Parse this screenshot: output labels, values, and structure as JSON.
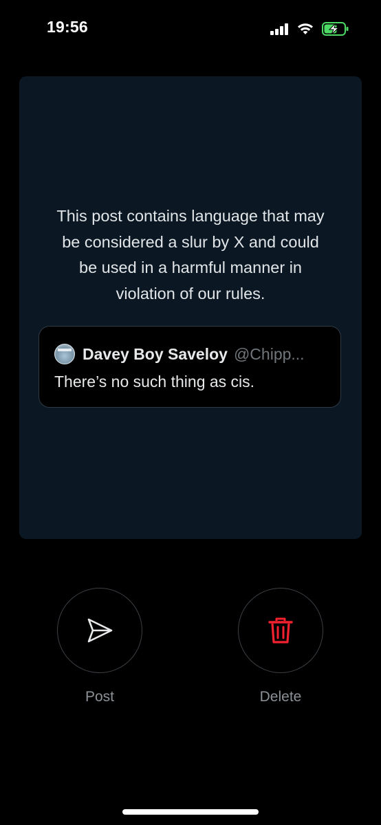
{
  "status_bar": {
    "time": "19:56",
    "icons": [
      "signal-icon",
      "wifi-icon",
      "battery-charging-icon"
    ],
    "battery_color": "#4cd964"
  },
  "moderation_notice": {
    "lines": [
      "This post contains language that may",
      "be considered a slur by X and could",
      "be used in a harmful manner in",
      "violation of our rules."
    ]
  },
  "quoted_post": {
    "display_name": "Davey Boy Saveloy",
    "handle": "@Chipp...",
    "text": "There’s no such thing as cis."
  },
  "actions": {
    "post_label": "Post",
    "post_icon": "send-icon",
    "delete_label": "Delete",
    "delete_icon": "trash-icon",
    "delete_color": "#f4212e"
  },
  "colors": {
    "background": "#000000",
    "card": "#0b1824",
    "text_primary": "#e7e9ea",
    "text_secondary": "#71767b"
  }
}
